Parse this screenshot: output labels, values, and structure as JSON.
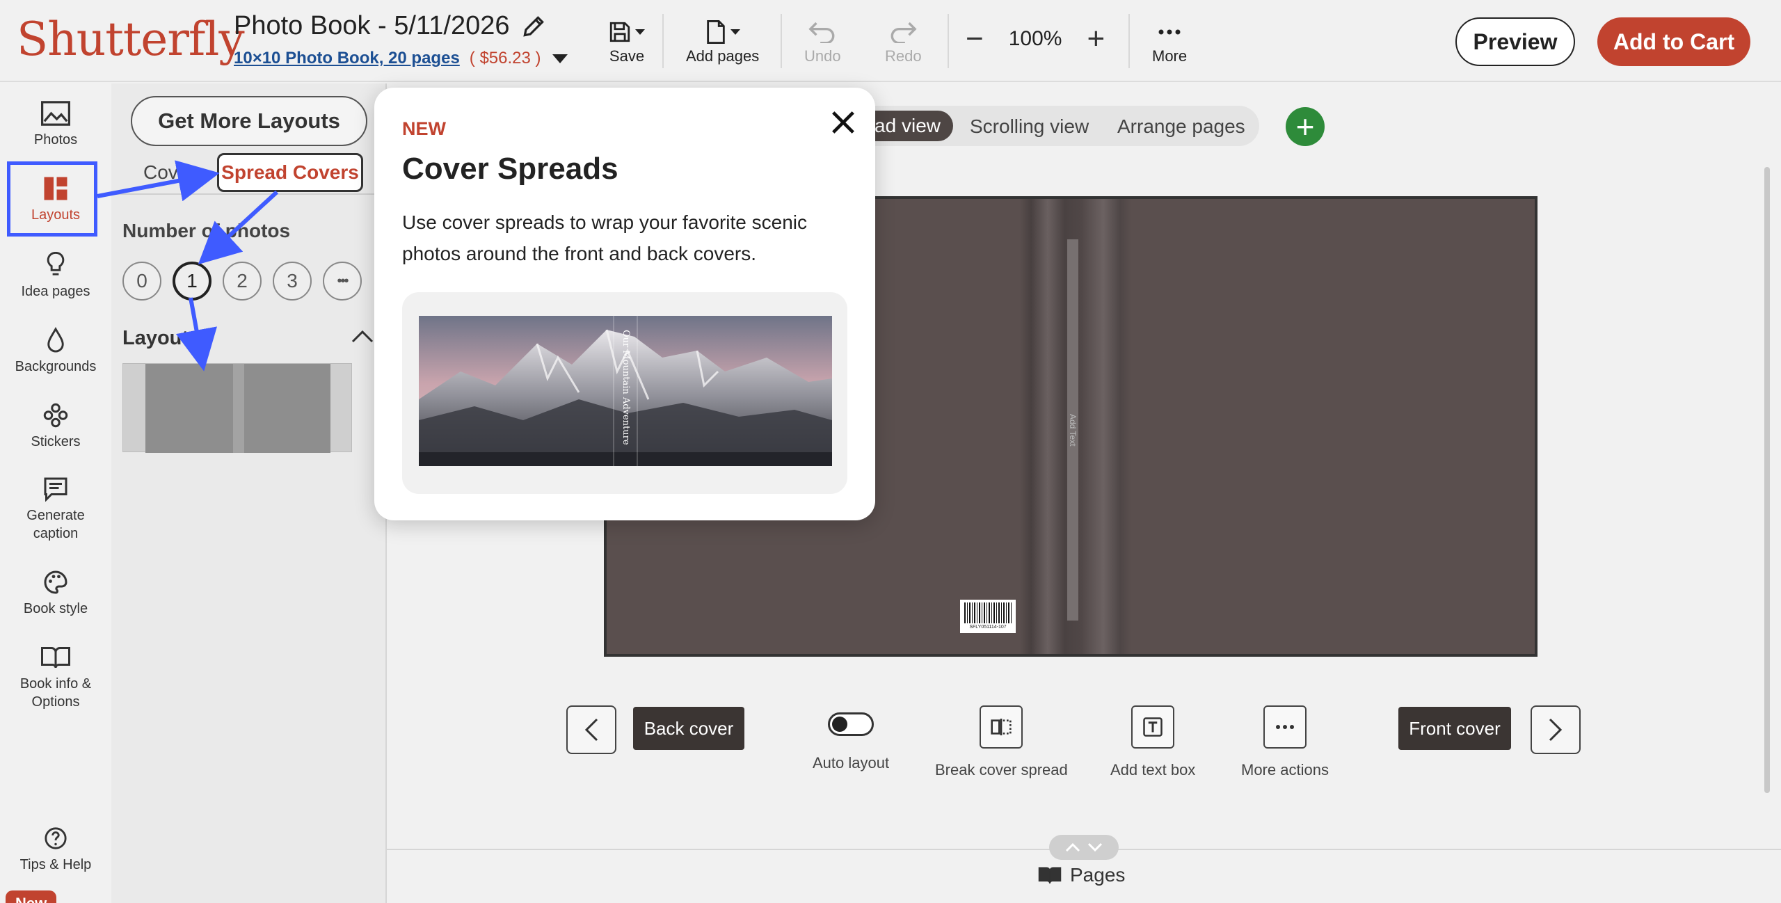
{
  "header": {
    "logo": "Shutterfly",
    "book_title": "Photo Book - 5/11/2026",
    "book_link": "10×10 Photo Book, 20 pages",
    "price": "( $56.23 )",
    "tools": {
      "save": "Save",
      "add_pages": "Add pages",
      "undo": "Undo",
      "redo": "Redo",
      "zoom": "100%",
      "more": "More"
    },
    "preview": "Preview",
    "add_to_cart": "Add to Cart"
  },
  "rail": {
    "items": [
      "Photos",
      "Layouts",
      "Idea pages",
      "Backgrounds",
      "Stickers",
      "Generate caption",
      "Book style",
      "Book info & Options",
      "Tips & Help"
    ],
    "new_badge": "New",
    "active": "Layouts"
  },
  "panel": {
    "get_more_layouts": "Get More Layouts",
    "tabs": [
      "Covers",
      "Spread Covers"
    ],
    "number_of_photos_title": "Number of photos",
    "number_options": [
      "0",
      "1",
      "2",
      "3",
      "•••"
    ],
    "selected_number": "1",
    "layouts_title": "Layouts"
  },
  "workspace": {
    "view_tabs": [
      "ead view",
      "Scrolling view",
      "Arrange pages"
    ],
    "spine_text": "Add Text",
    "barcode_number": "SFLY051114-107",
    "back_cover": "Back cover",
    "front_cover": "Front cover",
    "actions": [
      "Auto layout",
      "Break cover spread",
      "Add text box",
      "More actions"
    ],
    "pages_label": "Pages"
  },
  "modal": {
    "badge": "NEW",
    "title": "Cover Spreads",
    "description": "Use cover spreads to wrap your favorite scenic photos around the front and back covers.",
    "image_spine_text": "Our Mountain Adventure"
  },
  "colors": {
    "brand": "#c1432f",
    "annotation": "#3f5bff",
    "add_green": "#2e8b3a",
    "cover": "#5a4f4e"
  }
}
